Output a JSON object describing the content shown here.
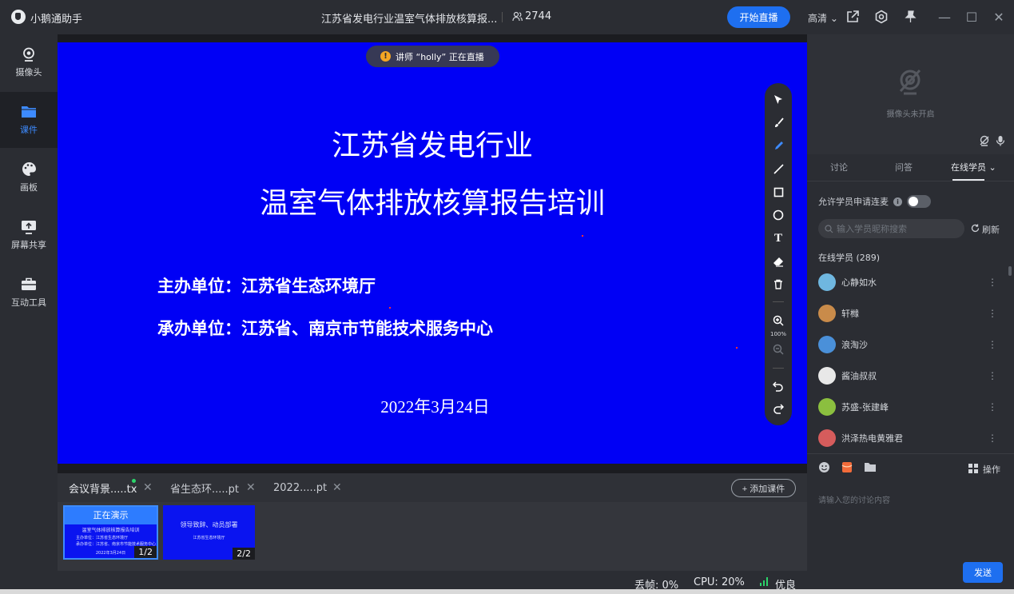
{
  "titlebar": {
    "app_name": "小鹅通助手",
    "course_title": "江苏省发电行业温室气体排放核算报...",
    "people_count": "2744",
    "start_live_label": "开始直播",
    "quality_label": "高清",
    "icons": [
      "logo-icon",
      "people-icon",
      "share-icon",
      "settings-icon",
      "pin-icon",
      "minimize-icon",
      "maximize-icon",
      "close-icon"
    ]
  },
  "sidebar": {
    "items": [
      {
        "label": "摄像头",
        "icon": "webcam-icon"
      },
      {
        "label": "课件",
        "icon": "folder-icon",
        "active": true
      },
      {
        "label": "画板",
        "icon": "palette-icon"
      },
      {
        "label": "屏幕共享",
        "icon": "screen-share-icon"
      },
      {
        "label": "互动工具",
        "icon": "toolbox-icon"
      }
    ],
    "active_color": "#3d8bff"
  },
  "stage": {
    "live_notice": "讲师 “holly” 正在直播",
    "slide_bg": "#0000f5",
    "slide": {
      "title1": "江苏省发电行业",
      "title2": "温室气体排放核算报告培训",
      "organizer": "主办单位：江苏省生态环境厅",
      "co_organizer": "承办单位：江苏省、南京市节能技术服务中心",
      "date": "2022年3月24日"
    },
    "draw_tools": {
      "items": [
        "cursor-icon",
        "brush-icon",
        "pen-icon",
        "line-icon",
        "rectangle-icon",
        "circle-icon",
        "text-icon",
        "eraser-icon",
        "trash-icon",
        "zoom-in-icon",
        "zoom-out-icon",
        "undo-icon",
        "redo-icon"
      ],
      "zoom_level": "100%"
    }
  },
  "files": {
    "tabs": [
      {
        "name": "会议背景.....tx",
        "active": true
      },
      {
        "name": "省生态环.....pt"
      },
      {
        "name": "2022.....pt"
      }
    ],
    "add_label": "+ 添加课件",
    "thumbs": [
      {
        "now_label": "正在演示",
        "line1": "温室气体排放核算报告培训",
        "line2": "主办单位：江苏省生态环境厅",
        "line3": "承办单位：江苏省、南京市节能技术服务中心",
        "line4": "2022年3月24日",
        "page": "1/2"
      },
      {
        "line1": "领导致辞、动员部署",
        "line2": "江苏省生态环境厅",
        "page": "2/2"
      }
    ]
  },
  "status": {
    "frame_drop": "丢帧:  0%",
    "cpu": "CPU:  20%",
    "network": "优良",
    "network_color": "#2bd46a"
  },
  "right_panel": {
    "camera_off": "摄像头未开启",
    "tabs": [
      "讨论",
      "问答",
      "在线学员"
    ],
    "active_tab": "在线学员",
    "allow_label": "允许学员申请连麦",
    "search_placeholder": "输入学员昵称搜索",
    "refresh_label": "刷新",
    "online_label": "在线学员  (289)",
    "users": [
      {
        "name": "心静如水",
        "color": "#6fb7e0"
      },
      {
        "name": "轩橼",
        "color": "#c98b4a"
      },
      {
        "name": "浪淘沙",
        "color": "#4a90d9"
      },
      {
        "name": "酱油叔叔",
        "color": "#e8e8e8"
      },
      {
        "name": "苏盛-张建峰",
        "color": "#8bbf3f"
      },
      {
        "name": "洪泽热电黄雅君",
        "color": "#d65c5c"
      }
    ],
    "ops_label": "操作",
    "chat_placeholder": "请输入您的讨论内容",
    "send_label": "发送"
  }
}
